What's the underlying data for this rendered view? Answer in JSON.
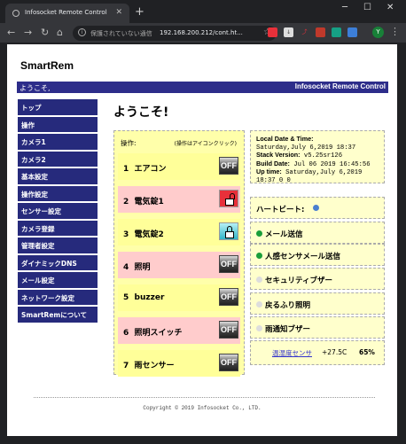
{
  "browser": {
    "tab_title": "Infosocket Remote Control",
    "security_label": "保護されていない通信",
    "url": "192.168.200.212/cont.ht...",
    "profile_initial": "Y"
  },
  "page": {
    "logo": "SmartRem",
    "banner_welcome": "ようこそ,",
    "banner_title": "Infosocket Remote Control",
    "welcome_heading": "ようこそ!",
    "sidebar": [
      {
        "label": "トップ"
      },
      {
        "label": "操作"
      },
      {
        "label": "カメラ1"
      },
      {
        "label": "カメラ2"
      },
      {
        "label": "基本設定"
      },
      {
        "label": "操作設定"
      },
      {
        "label": "センサー設定"
      },
      {
        "label": "カメラ登録"
      },
      {
        "label": "管理者設定"
      },
      {
        "label": "ダイナミックDNS"
      },
      {
        "label": "メール設定"
      },
      {
        "label": "ネットワーク設定"
      },
      {
        "label": "SmartRemについて"
      }
    ],
    "operations": {
      "title": "操作:",
      "hint": "(操作はアイコンクリック)",
      "devices": [
        {
          "num": "1",
          "name": "エアコン",
          "state": "OFF",
          "icon": "off-icon",
          "bg": "#ffff99"
        },
        {
          "num": "2",
          "name": "電気錠1",
          "state": "",
          "icon": "lock-unlocked-icon",
          "bg": "#ffcccc"
        },
        {
          "num": "3",
          "name": "電気錠2",
          "state": "",
          "icon": "lock-locked-icon",
          "bg": "#ffff99"
        },
        {
          "num": "4",
          "name": "照明",
          "state": "OFF",
          "icon": "off-icon",
          "bg": "#ffcccc"
        },
        {
          "num": "5",
          "name": "buzzer",
          "state": "OFF",
          "icon": "off-icon",
          "bg": "#ffff99"
        },
        {
          "num": "6",
          "name": "照明スイッチ",
          "state": "OFF",
          "icon": "off-icon",
          "bg": "#ffcccc"
        },
        {
          "num": "7",
          "name": "雨センサー",
          "state": "OFF",
          "icon": "off-icon",
          "bg": "#ffff99"
        }
      ]
    },
    "info": {
      "local_date_label": "Local Date & Time:",
      "local_date_value": "Saturday,July 6,2019 18:37",
      "stack_label": "Stack Version:",
      "stack_value": "v5.25sr126",
      "build_label": "Build Date:",
      "build_value": "Jul 06 2019 16:45:56",
      "uptime_label": "Up time:",
      "uptime_value": "Saturday,July 6,2019",
      "uptime_value2": "18:37 0 0"
    },
    "status": {
      "heartbeat": "ハートビート:",
      "items": [
        {
          "label": "メール送信",
          "color": "#1a9e3a"
        },
        {
          "label": "人感センサメール送信",
          "color": "#1a9e3a"
        },
        {
          "label": "セキュリティブザー",
          "color": "#dddddd"
        },
        {
          "label": "戻るふり照明",
          "color": "#dddddd"
        },
        {
          "label": "雨通知ブザー",
          "color": "#dddddd"
        }
      ],
      "sensor_label": "温湿度センサ",
      "sensor_temp": "+27.5C",
      "sensor_hum": "65%"
    },
    "footer": "Copyright © 2019 Infosocket Co., LTD."
  }
}
